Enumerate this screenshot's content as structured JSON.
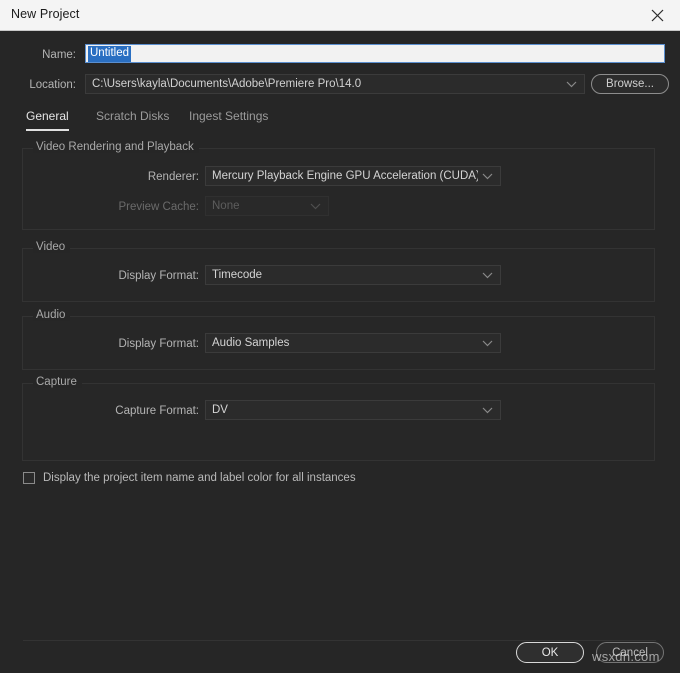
{
  "window": {
    "title": "New Project",
    "close_icon": "close-icon"
  },
  "fields": {
    "name_label": "Name:",
    "name_value": "Untitled",
    "location_label": "Location:",
    "location_value": "C:\\Users\\kayla\\Documents\\Adobe\\Premiere Pro\\14.0",
    "browse_label": "Browse..."
  },
  "tabs": [
    {
      "label": "General",
      "active": true
    },
    {
      "label": "Scratch Disks",
      "active": false
    },
    {
      "label": "Ingest Settings",
      "active": false
    }
  ],
  "groups": {
    "video_rendering": {
      "title": "Video Rendering and Playback",
      "renderer_label": "Renderer:",
      "renderer_value": "Mercury Playback Engine GPU Acceleration (CUDA)",
      "preview_cache_label": "Preview Cache:",
      "preview_cache_value": "None"
    },
    "video": {
      "title": "Video",
      "display_format_label": "Display Format:",
      "display_format_value": "Timecode"
    },
    "audio": {
      "title": "Audio",
      "display_format_label": "Display Format:",
      "display_format_value": "Audio Samples"
    },
    "capture": {
      "title": "Capture",
      "capture_format_label": "Capture Format:",
      "capture_format_value": "DV"
    }
  },
  "options": {
    "display_project_item_label": "Display the project item name and label color for all instances"
  },
  "footer": {
    "ok_label": "OK",
    "cancel_label": "Cancel"
  },
  "watermark": "wsxdn.com",
  "colors": {
    "dialog_bg": "#262626",
    "titlebar_bg": "#f4f4f4",
    "selection_blue": "#2a6fc2",
    "field_focus_border": "#5b8fcf"
  }
}
